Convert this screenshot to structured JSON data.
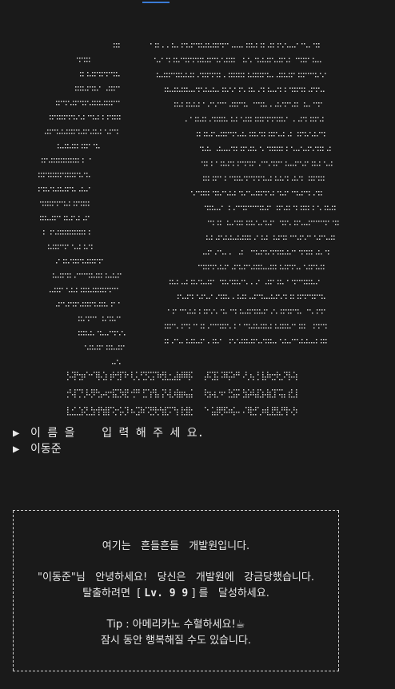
{
  "prompts": [
    {
      "arrow": "▶",
      "text": "이 름 을    입 력 해 주 세 요."
    },
    {
      "arrow": "▶",
      "text": "이동준"
    }
  ],
  "message_box": {
    "line1": "여기는   흔들흔들   개발원입니다.",
    "line2": "\"이동준\"님   안녕하세요!   당신은   개발원에   강금당했습니다.",
    "line3_before": "탈출하려면  [ ",
    "line3_level": "Lv. 9 9",
    "line3_after": " ] 를   달성하세요.",
    "tip_line1": "Tip : 아메리카노 수혈하세요!☕",
    "tip_line2": "잠시 동안 행복해질 수도 있습니다."
  },
  "colors": {
    "background": "#1a1a1a",
    "text": "#e8e8e8",
    "tab_accent": "#3a7bd5"
  }
}
